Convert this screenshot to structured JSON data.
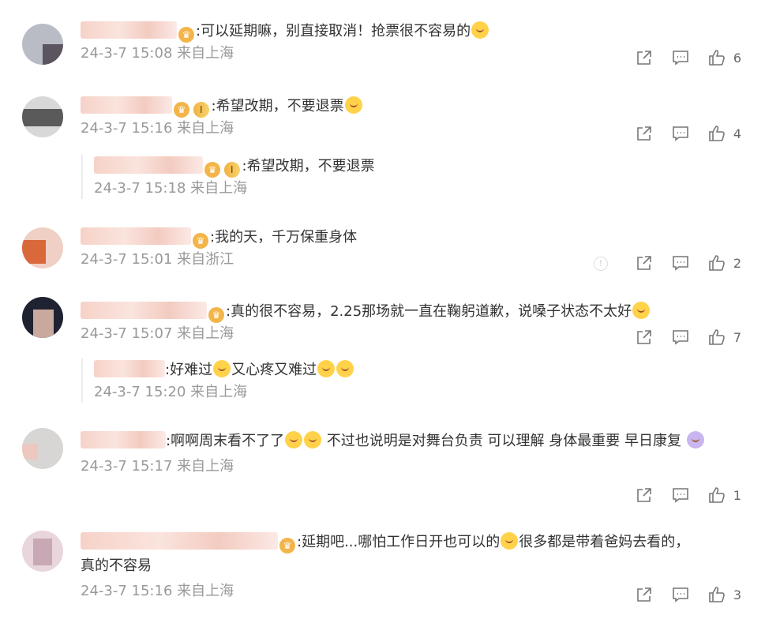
{
  "comments": [
    {
      "text": ":可以延期嘛，别直接取消！抢票很不容易的",
      "time": "24-3-7 15:08",
      "location": "来自上海",
      "likes": "6"
    },
    {
      "badge": "I",
      "text": ":希望改期，不要退票",
      "time": "24-3-7 15:16",
      "location": "来自上海",
      "likes": "4",
      "reply": {
        "badge": "I",
        "text": ":希望改期，不要退票",
        "time": "24-3-7 15:18",
        "location": "来自上海"
      }
    },
    {
      "text": ":我的天，千万保重身体",
      "time": "24-3-7 15:01",
      "location": "来自浙江",
      "likes": "2"
    },
    {
      "text": ":真的很不容易，2.25那场就一直在鞠躬道歉，说嗓子状态不太好",
      "time": "24-3-7 15:07",
      "location": "来自上海",
      "likes": "7",
      "reply": {
        "text_a": ":好难过",
        "text_b": "又心疼又难过",
        "time": "24-3-7 15:20",
        "location": "来自上海"
      }
    },
    {
      "text_a": ":啊啊周末看不了了",
      "text_b": " 不过也说明是对舞台负责 可以理解  身体最重要 早日康复",
      "time": "24-3-7 15:17",
      "location": "来自上海",
      "likes": "1"
    },
    {
      "text_a": ":延期吧...哪怕工作日开也可以的",
      "text_b": "很多都是带着爸妈去看的，",
      "text_c": "真的不容易",
      "time": "24-3-7 15:16",
      "location": "来自上海",
      "likes": "3"
    }
  ],
  "icons": {
    "share": "share-icon",
    "comment": "comment-icon",
    "like": "thumbs-up-icon",
    "crown": "crown-icon",
    "emoji": "emoji-icon"
  }
}
